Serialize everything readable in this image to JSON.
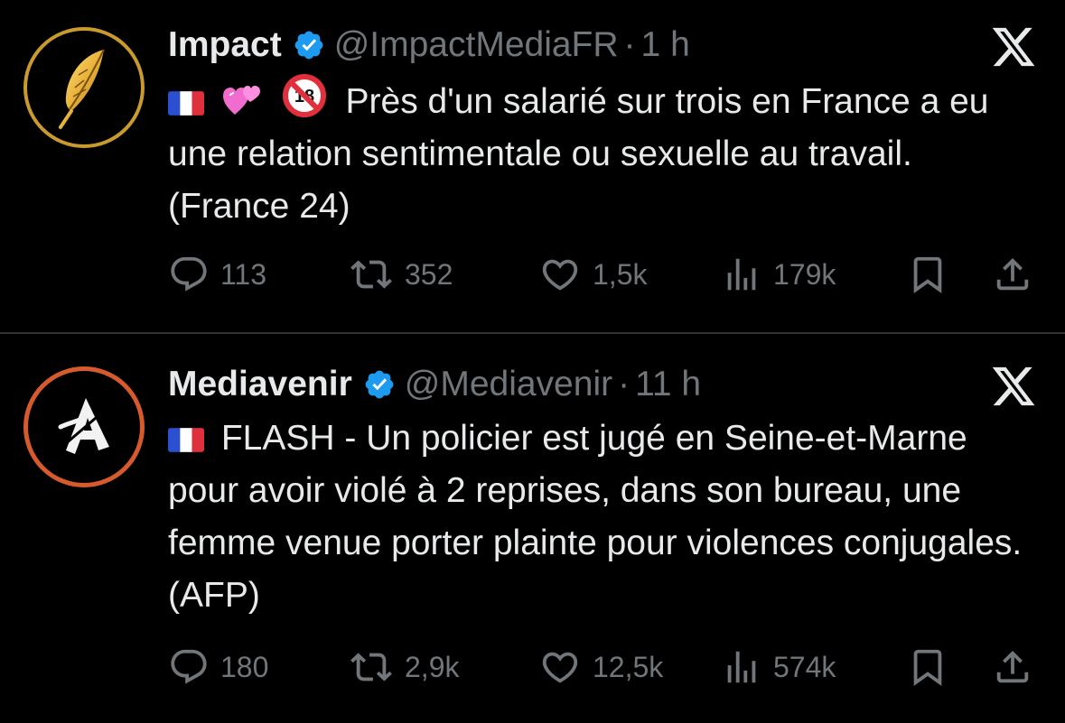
{
  "tweets": [
    {
      "display_name": "Impact",
      "handle": "@ImpactMediaFR",
      "separator": "·",
      "time": "1 h",
      "emojis": [
        "flag-france",
        "two-hearts",
        "no-one-under-eighteen"
      ],
      "text": "Près d'un salarié sur trois en France a eu une relation sentimentale ou sexuelle au travail. (France 24)",
      "replies": "113",
      "reposts": "352",
      "likes": "1,5k",
      "views": "179k"
    },
    {
      "display_name": "Mediavenir",
      "handle": "@Mediavenir",
      "separator": "·",
      "time": "11 h",
      "emojis": [
        "flag-france"
      ],
      "text": "FLASH - Un policier est jugé en Seine-et-Marne pour avoir violé à 2 reprises, dans son bureau, une femme venue porter plainte pour violences conjugales. (AFP)",
      "replies": "180",
      "reposts": "2,9k",
      "likes": "12,5k",
      "views": "574k"
    }
  ],
  "colors": {
    "background": "#000000",
    "text": "#e7e9ea",
    "muted": "#71767b",
    "verified": "#1d9bf0",
    "divider": "#2f3336",
    "impact_ring": "#c99a2e",
    "mediavenir_ring": "#d65a2c"
  },
  "icons": [
    "verified-badge-icon",
    "x-logo-icon",
    "reply-icon",
    "repost-icon",
    "like-icon",
    "views-icon",
    "bookmark-icon",
    "share-icon"
  ]
}
